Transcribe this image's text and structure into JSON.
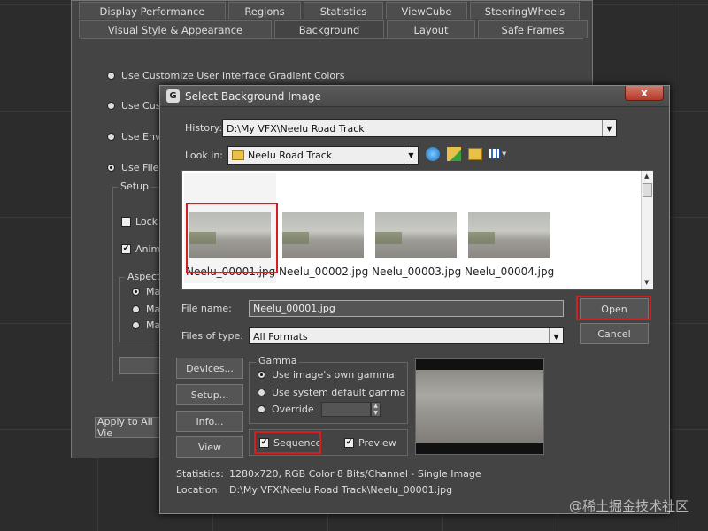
{
  "bg_dialog": {
    "tabs_row1": [
      "Display Performance",
      "Regions",
      "Statistics",
      "ViewCube",
      "SteeringWheels"
    ],
    "tabs_row2": [
      "Visual Style & Appearance",
      "Background",
      "Layout",
      "Safe Frames"
    ],
    "options": [
      "Use Customize User Interface Gradient Colors",
      "Use Cust",
      "Use Envi",
      "Use Files"
    ],
    "setup_label": "Setup",
    "lock_label": "Lock",
    "anim_label": "Anima",
    "aspect_label": "Aspect",
    "aspect_opts": [
      "Ma",
      "Ma",
      "Ma"
    ],
    "apply_label": "Apply to All Vie"
  },
  "dialog": {
    "title": "Select Background Image",
    "close_glyph": "x",
    "history_label": "History:",
    "history_value": "D:\\My VFX\\Neelu Road Track",
    "lookin_label": "Look in:",
    "lookin_value": "Neelu Road Track",
    "files": [
      "Neelu_00001.jpg",
      "Neelu_00002.jpg",
      "Neelu_00003.jpg",
      "Neelu_00004.jpg"
    ],
    "filename_label": "File name:",
    "filename_value": "Neelu_00001.jpg",
    "filetype_label": "Files of type:",
    "filetype_value": "All Formats",
    "open_label": "Open",
    "cancel_label": "Cancel",
    "devices_label": "Devices...",
    "setup_label": "Setup...",
    "info_label": "Info...",
    "view_label": "View",
    "gamma_title": "Gamma",
    "gamma_opt1": "Use image's own gamma",
    "gamma_opt2": "Use system default gamma",
    "gamma_opt3": "Override",
    "sequence_label": "Sequence",
    "preview_label": "Preview",
    "statistics_label": "Statistics:",
    "statistics_value": "1280x720, RGB Color 8 Bits/Channel - Single Image",
    "location_label": "Location:",
    "location_value": "D:\\My VFX\\Neelu Road Track\\Neelu_00001.jpg"
  },
  "watermark": "@稀土掘金技术社区",
  "colors": {
    "highlight": "#d21f1f",
    "dialog_bg": "#444444"
  }
}
